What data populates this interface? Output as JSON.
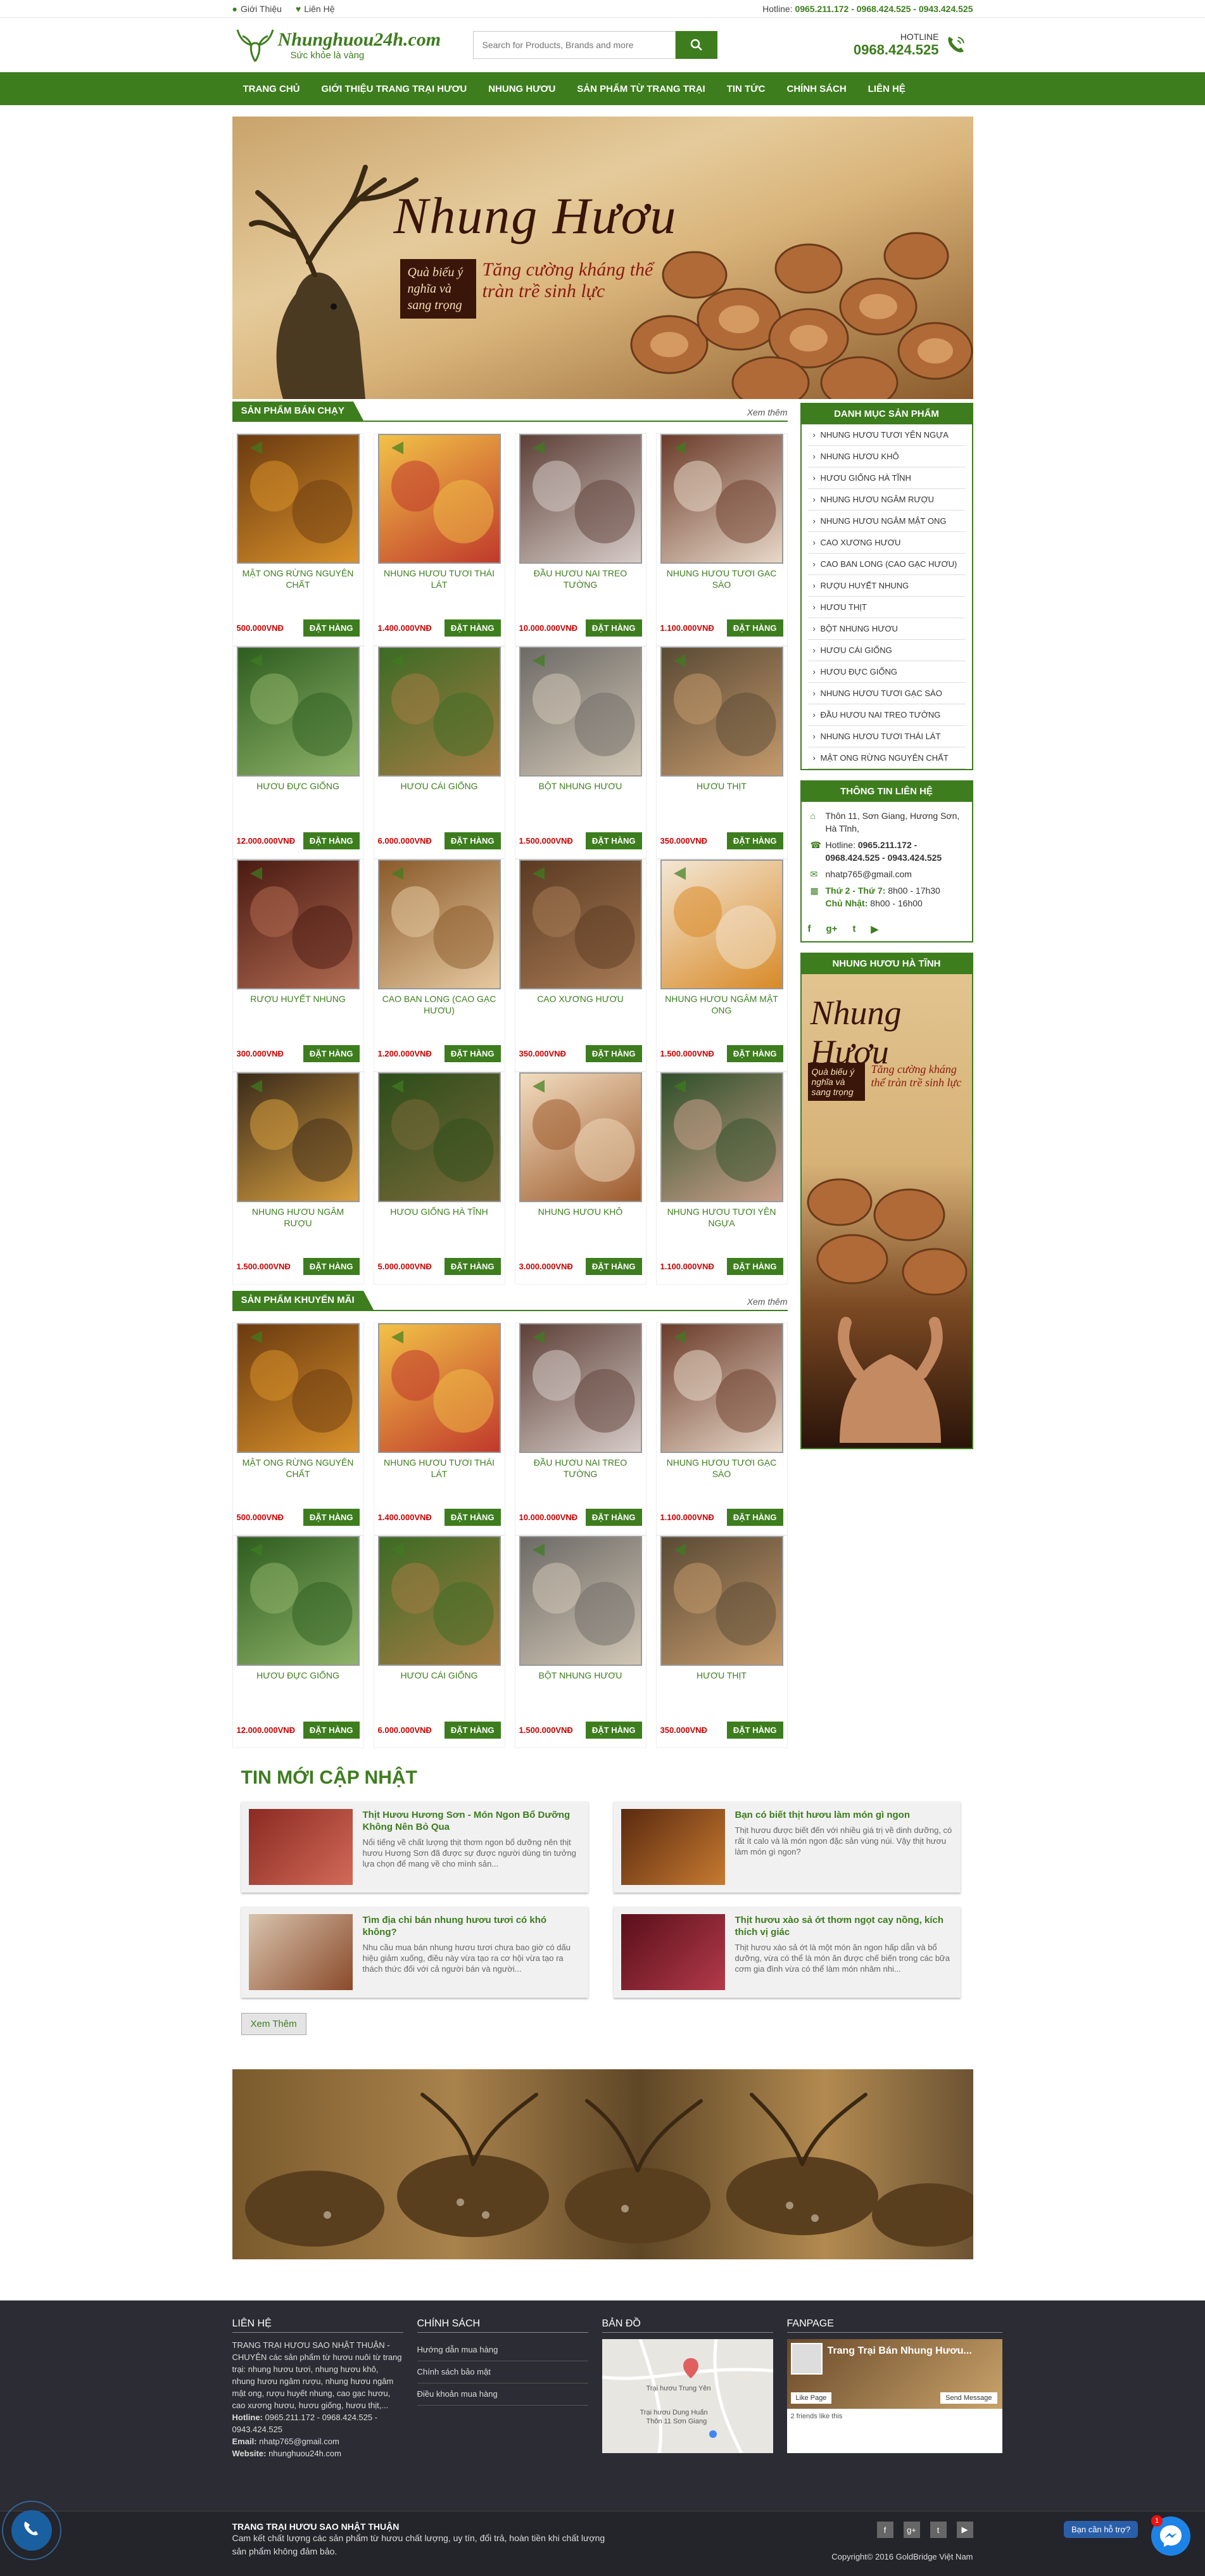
{
  "topbar": {
    "about": "Giới Thiệu",
    "contact": "Liên Hệ",
    "hotline_label": "Hotline:",
    "hotline_numbers": "0965.211.172 - 0968.424.525 - 0943.424.525"
  },
  "header": {
    "logo_name": "Nhunghuou24h.com",
    "logo_slogan": "Sức khỏe là vàng",
    "search_placeholder": "Search for Products, Brands and more",
    "hotline_label": "HOTLINE",
    "hotline_number": "0968.424.525"
  },
  "nav": [
    "TRANG CHỦ",
    "GIỚI THIỆU TRANG TRẠI HƯƠU",
    "NHUNG HƯƠU",
    "SẢN PHẨM TỪ TRANG TRẠI",
    "TIN TỨC",
    "CHÍNH SÁCH",
    "LIÊN HỆ"
  ],
  "banner": {
    "title": "Nhung Hươu",
    "tag": "Quà biếu ý nghĩa và sang trọng",
    "slogan": "Tăng cường kháng thể tràn trề sinh lực"
  },
  "bestseller": {
    "title": "SẢN PHẨM BÁN CHẠY",
    "more": "Xem thêm",
    "items": [
      {
        "name": "MẬT ONG RỪNG NGUYÊN CHẤT",
        "price": "500.000VNĐ",
        "buy": "ĐẶT HÀNG",
        "img": "honey-bottles-image",
        "c1": "#6a3a10",
        "c2": "#d9912a"
      },
      {
        "name": "NHUNG HƯƠU TƯƠI THÁI LÁT",
        "price": "1.400.000VNĐ",
        "buy": "ĐẶT HÀNG",
        "img": "sliced-antler-image",
        "c1": "#f2c247",
        "c2": "#c0392b"
      },
      {
        "name": "ĐẦU HƯƠU NAI TREO TƯỜNG",
        "price": "10.000.000VNĐ",
        "buy": "ĐẶT HÀNG",
        "img": "deer-head-mount-image",
        "c1": "#5d4037",
        "c2": "#d7ccc8"
      },
      {
        "name": "NHUNG HƯƠU TƯƠI GẠC SÀO",
        "price": "1.100.000VNĐ",
        "buy": "ĐẶT HÀNG",
        "img": "antler-branch-image",
        "c1": "#6b3b2a",
        "c2": "#e8d8c8"
      },
      {
        "name": "HƯƠU ĐỰC GIỐNG",
        "price": "12.000.000VNĐ",
        "buy": "ĐẶT HÀNG",
        "img": "stag-image",
        "c1": "#2e5d1f",
        "c2": "#8fb36a"
      },
      {
        "name": "HƯƠU CÁI GIỐNG",
        "price": "6.000.000VNĐ",
        "buy": "ĐẶT HÀNG",
        "img": "doe-image",
        "c1": "#3c6b24",
        "c2": "#a67c45"
      },
      {
        "name": "BỘT NHUNG HƯƠU",
        "price": "1.500.000VNĐ",
        "buy": "ĐẶT HÀNG",
        "img": "antler-powder-image",
        "c1": "#6d6a66",
        "c2": "#d2c7b6"
      },
      {
        "name": "HƯƠU THỊT",
        "price": "350.000VNĐ",
        "buy": "ĐẶT HÀNG",
        "img": "deer-meat-image",
        "c1": "#5a4a35",
        "c2": "#c49a6c"
      },
      {
        "name": "RƯỢU HUYẾT NHUNG",
        "price": "300.000VNĐ",
        "buy": "ĐẶT HÀNG",
        "img": "blood-wine-image",
        "c1": "#4a1a12",
        "c2": "#b06a50"
      },
      {
        "name": "CAO BAN LONG (CAO GẠC HƯƠU)",
        "price": "1.200.000VNĐ",
        "buy": "ĐẶT HÀNG",
        "img": "antler-glue-image",
        "c1": "#8a5a2a",
        "c2": "#e6c9a0"
      },
      {
        "name": "CAO XƯƠNG HƯƠU",
        "price": "350.000VNĐ",
        "buy": "ĐẶT HÀNG",
        "img": "bone-glue-image",
        "c1": "#5b3a22",
        "c2": "#a77b55"
      },
      {
        "name": "NHUNG HƯƠU NGÂM MẬT ONG",
        "price": "1.500.000VNĐ",
        "buy": "ĐẶT HÀNG",
        "img": "antler-honey-image",
        "c1": "#f3e7d5",
        "c2": "#d88a28"
      },
      {
        "name": "NHUNG HƯƠU NGÂM RƯỢU",
        "price": "1.500.000VNĐ",
        "buy": "ĐẶT HÀNG",
        "img": "antler-wine-image",
        "c1": "#3a2a1a",
        "c2": "#d8a040"
      },
      {
        "name": "HƯƠU GIỐNG HÀ TĨNH",
        "price": "5.000.000VNĐ",
        "buy": "ĐẶT HÀNG",
        "img": "ha-tinh-deer-image",
        "c1": "#2c4d1a",
        "c2": "#7a6a3a"
      },
      {
        "name": "NHUNG HƯƠU KHÔ",
        "price": "3.000.000VNĐ",
        "buy": "ĐẶT HÀNG",
        "img": "dried-antler-image",
        "c1": "#f2ddc0",
        "c2": "#9c5a2c"
      },
      {
        "name": "NHUNG HƯƠU TƯƠI YÊN NGỰA",
        "price": "1.100.000VNĐ",
        "buy": "ĐẶT HÀNG",
        "img": "saddle-antler-image",
        "c1": "#2f4f2a",
        "c2": "#c9a08a"
      }
    ]
  },
  "promo": {
    "title": "SẢN PHẨM KHUYẾN MÃI",
    "more": "Xem thêm",
    "items": [
      {
        "name": "MẬT ONG RỪNG NGUYÊN CHẤT",
        "price": "500.000VNĐ",
        "buy": "ĐẶT HÀNG",
        "img": "honey-bottles-image",
        "c1": "#6a3a10",
        "c2": "#d9912a"
      },
      {
        "name": "NHUNG HƯƠU TƯƠI THÁI LÁT",
        "price": "1.400.000VNĐ",
        "buy": "ĐẶT HÀNG",
        "img": "sliced-antler-image",
        "c1": "#f2c247",
        "c2": "#c0392b"
      },
      {
        "name": "ĐẦU HƯƠU NAI TREO TƯỜNG",
        "price": "10.000.000VNĐ",
        "buy": "ĐẶT HÀNG",
        "img": "deer-head-mount-image",
        "c1": "#5d4037",
        "c2": "#d7ccc8"
      },
      {
        "name": "NHUNG HƯƠU TƯƠI GẠC SÀO",
        "price": "1.100.000VNĐ",
        "buy": "ĐẶT HÀNG",
        "img": "antler-branch-image",
        "c1": "#6b3b2a",
        "c2": "#e8d8c8"
      },
      {
        "name": "HƯƠU ĐỰC GIỐNG",
        "price": "12.000.000VNĐ",
        "buy": "ĐẶT HÀNG",
        "img": "stag-image",
        "c1": "#2e5d1f",
        "c2": "#8fb36a"
      },
      {
        "name": "HƯƠU CÁI GIỐNG",
        "price": "6.000.000VNĐ",
        "buy": "ĐẶT HÀNG",
        "img": "doe-image",
        "c1": "#3c6b24",
        "c2": "#a67c45"
      },
      {
        "name": "BỘT NHUNG HƯƠU",
        "price": "1.500.000VNĐ",
        "buy": "ĐẶT HÀNG",
        "img": "antler-powder-image",
        "c1": "#6d6a66",
        "c2": "#d2c7b6"
      },
      {
        "name": "HƯƠU THỊT",
        "price": "350.000VNĐ",
        "buy": "ĐẶT HÀNG",
        "img": "deer-meat-image",
        "c1": "#5a4a35",
        "c2": "#c49a6c"
      }
    ]
  },
  "sidebar": {
    "categories_title": "DANH MỤC SẢN PHẨM",
    "categories": [
      "NHUNG HƯƠU TƯƠI YÊN NGỰA",
      "NHUNG HƯƠU KHÔ",
      "HƯƠU GIỐNG HÀ TĨNH",
      "NHUNG HƯƠU NGÂM RƯỢU",
      "NHUNG HƯƠU NGÂM MẬT ONG",
      "CAO XƯƠNG HƯƠU",
      "CAO BAN LONG (CAO GẠC HƯƠU)",
      "RƯỢU HUYẾT NHUNG",
      "HƯƠU THỊT",
      "BỘT NHUNG HƯƠU",
      "HƯƠU CÁI GIỐNG",
      "HƯƠU ĐỰC GIỐNG",
      "NHUNG HƯƠU TƯƠI GẠC SÀO",
      "ĐẦU HƯƠU NAI TREO TƯỜNG",
      "NHUNG HƯƠU TƯƠI THÁI LÁT",
      "MẬT ONG RỪNG NGUYÊN CHẤT"
    ],
    "contact_title": "THÔNG TIN LIÊN HỆ",
    "address": "Thôn 11, Sơn Giang, Hương Sơn, Hà Tĩnh,",
    "hotline_label": "Hotline:",
    "hotline": "0965.211.172 - 0968.424.525 - 0943.424.525",
    "email": "nhatp765@gmail.com",
    "weekday_label": "Thứ 2 - Thứ 7:",
    "weekday_hours": "8h00 - 17h30",
    "sunday_label": "Chủ Nhật:",
    "sunday_hours": "8h00 - 16h00",
    "promo_title": "NHUNG HƯƠU HÀ TĨNH",
    "promo_banner_title": "Nhung Hươu",
    "promo_banner_tag": "Quà biếu ý nghĩa và sang trọng",
    "promo_banner_slogan": "Tăng cường kháng thể tràn trề sinh lực"
  },
  "news": {
    "title": "TIN MỚI CẬP NHẬT",
    "more": "Xem Thêm",
    "items": [
      {
        "title": "Thịt Hươu Hương Sơn - Món Ngon Bổ Dưỡng Không Nên Bỏ Qua",
        "desc": "Nổi tiếng về chất lượng thịt thơm ngon bổ dưỡng nên thịt hươu Hương Sơn đã được sự được người dùng tin tưởng lựa chọn để mang về cho mình sản...",
        "c1": "#8a2a22",
        "c2": "#d26a58"
      },
      {
        "title": "Bạn có biết thịt hươu làm món gì ngon",
        "desc": "Thịt hươu được biết đến với nhiều giá trị về dinh dưỡng, có rất ít calo và là món ngon đặc sản vùng núi. Vậy thịt hươu làm món gì ngon?",
        "c1": "#5a2a10",
        "c2": "#c77a30"
      },
      {
        "title": "Tìm địa chỉ bán nhung hươu tươi có khó không?",
        "desc": "Nhu cầu mua bán nhung hươu tươi chưa bao giờ có dấu hiệu giảm xuống, điều này vừa tạo ra cơ hội vừa tạo ra thách thức đối với cả người bán và người...",
        "c1": "#d9c4ae",
        "c2": "#8a4a2a"
      },
      {
        "title": "Thịt hươu xào sả ớt thơm ngọt cay nồng, kích thích vị giác",
        "desc": "Thịt hươu xào sả ớt là một món ăn ngon hấp dẫn và bổ dưỡng, vừa có thể là món ăn được chế biến trong các bữa cơm gia đình vừa có thể làm món nhâm nhi...",
        "c1": "#5a0f1a",
        "c2": "#b23a4a"
      }
    ]
  },
  "footer": {
    "col1_title": "LIÊN HỆ",
    "col1_text": "TRANG TRẠI HƯƠU SAO NHẬT THUẬN - CHUYÊN các sản phẩm từ hươu nuôi từ trang trại: nhung hươu tươi, nhung hươu khô, nhung hươu ngâm rượu, nhung hươu ngâm mật ong, rượu huyết nhung, cao gạc hươu, cao xương hươu, hươu giống, hươu thịt,...",
    "hotline_label": "Hotline:",
    "hotline": "0965.211.172 - 0968.424.525 - 0943.424.525",
    "email_label": "Email:",
    "email": "nhatp765@gmail.com",
    "website_label": "Website:",
    "website": "nhunghuou24h.com",
    "col2_title": "CHÍNH SÁCH",
    "col2_links": [
      "Hướng dẫn mua hàng",
      "Chính sách bảo mật",
      "Điều khoản mua hàng"
    ],
    "col3_title": "BẢN ĐỒ",
    "map_label1": "Trại hươu Trung Yên",
    "map_label2": "Trại hươu Dung Huấn",
    "map_label3": "Thôn 11 Sơn Giang",
    "col4_title": "FANPAGE",
    "fb_page": "Trang Trại Bán Nhung Hươu...",
    "fb_like": "Like Page",
    "fb_send": "Send Message",
    "fb_count": "2 friends like this",
    "bottom_title": "TRANG TRẠI HƯƠU SAO NHẬT THUẬN",
    "bottom_desc": "Cam kết chất lượng các sản phẩm từ hươu chất lượng, uy tín, đổi trả, hoàn tiền khi chất lượng sản phẩm không đảm bảo.",
    "copyright": "Copyright© 2016 GoldBridge Việt Nam",
    "social": [
      "f",
      "g+",
      "t",
      "▶"
    ]
  },
  "floating": {
    "chat_label": "Bạn cần hỗ trợ?",
    "badge": "1"
  }
}
